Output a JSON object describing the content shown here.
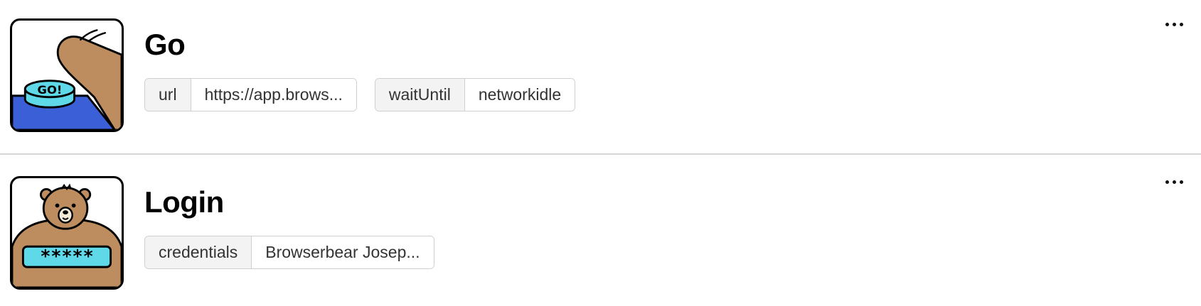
{
  "steps": [
    {
      "title": "Go",
      "icon": "go-button-finger-icon",
      "params": [
        {
          "key": "url",
          "value": "https://app.brows..."
        },
        {
          "key": "waitUntil",
          "value": "networkidle"
        }
      ]
    },
    {
      "title": "Login",
      "icon": "bear-password-icon",
      "params": [
        {
          "key": "credentials",
          "value": "Browserbear Josep..."
        }
      ]
    }
  ],
  "colors": {
    "divider": "#d6d6d6",
    "param_key_bg": "#f3f3f3",
    "param_border": "#cfcfcf",
    "accent_blue": "#3b5fd6",
    "accent_cyan": "#5fd8e8",
    "bear_brown": "#bd8d5f"
  }
}
